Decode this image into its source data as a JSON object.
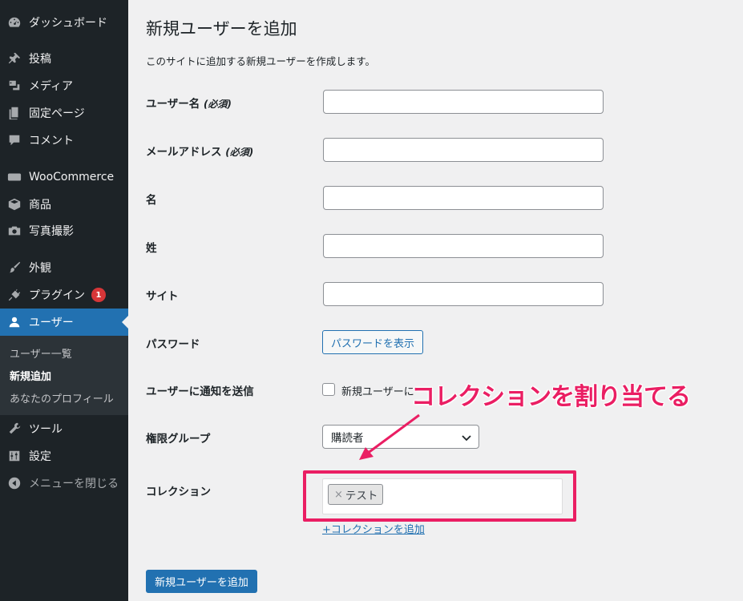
{
  "sidebar": {
    "items": [
      {
        "label": "ダッシュボード",
        "icon": "dashboard-icon"
      },
      {
        "label": "投稿",
        "icon": "pin-icon"
      },
      {
        "label": "メディア",
        "icon": "media-icon"
      },
      {
        "label": "固定ページ",
        "icon": "page-icon"
      },
      {
        "label": "コメント",
        "icon": "comment-icon"
      },
      {
        "label": "WooCommerce",
        "icon": "woo-icon"
      },
      {
        "label": "商品",
        "icon": "box-icon"
      },
      {
        "label": "写真撮影",
        "icon": "camera-icon"
      },
      {
        "label": "外観",
        "icon": "brush-icon"
      },
      {
        "label": "プラグイン",
        "icon": "plugin-icon",
        "badge": "1"
      },
      {
        "label": "ユーザー",
        "icon": "user-icon"
      },
      {
        "label": "ツール",
        "icon": "wrench-icon"
      },
      {
        "label": "設定",
        "icon": "settings-icon"
      },
      {
        "label": "メニューを閉じる",
        "icon": "collapse-icon"
      }
    ],
    "submenu": [
      "ユーザー一覧",
      "新規追加",
      "あなたのプロフィール"
    ]
  },
  "main": {
    "title": "新規ユーザーを追加",
    "description": "このサイトに追加する新規ユーザーを作成します。",
    "fields": {
      "username": {
        "label": "ユーザー名",
        "required": "(必須)"
      },
      "email": {
        "label": "メールアドレス",
        "required": "(必須)"
      },
      "first_name": {
        "label": "名"
      },
      "last_name": {
        "label": "姓"
      },
      "site": {
        "label": "サイト"
      },
      "password": {
        "label": "パスワード",
        "button": "パスワードを表示"
      },
      "notify": {
        "label": "ユーザーに通知を送信",
        "checkbox_label": "新規ユーザーに"
      },
      "role": {
        "label": "権限グループ",
        "value": "購読者"
      },
      "collection": {
        "label": "コレクション",
        "tag": "テスト",
        "tag_remove": "×",
        "add_link": "+コレクションを追加"
      }
    },
    "submit": "新規ユーザーを追加"
  },
  "annotation": {
    "callout": "コレクションを割り当てる",
    "color": "#ea1e63"
  },
  "colors": {
    "sidebar": "#1d2327",
    "accent": "#2271b1",
    "badge": "#d63638"
  }
}
